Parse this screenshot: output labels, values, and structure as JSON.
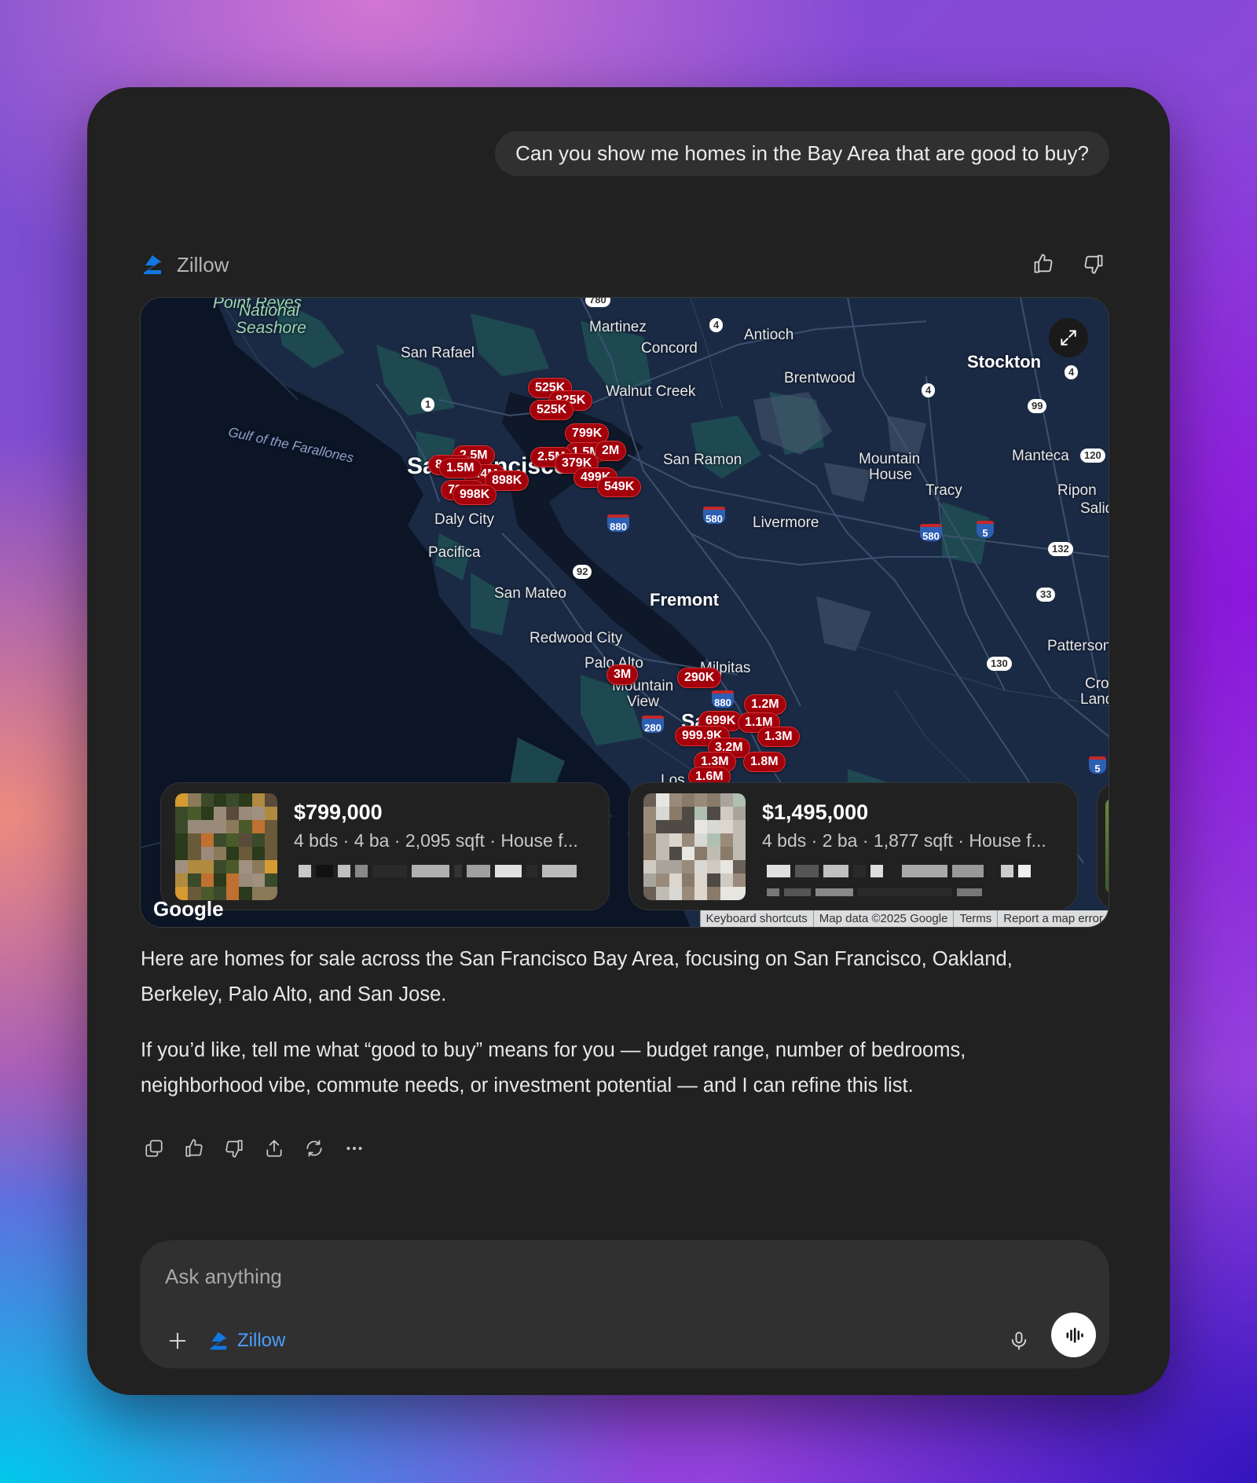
{
  "conversation": {
    "user_message": "Can you show me homes in the Bay Area that are good to buy?",
    "tool_name": "Zillow",
    "paragraphs": [
      "Here are homes for sale across the San Francisco Bay Area, focusing on San Francisco, Oakland, Berkeley, Palo Alto, and San Jose.",
      "If you’d like, tell me what “good to buy” means for you — budget range, number of bedrooms, neighborhood vibe, commute needs, or investment potential — and I can refine this list."
    ]
  },
  "map": {
    "places": {
      "point_reyes_1": "National",
      "point_reyes_2": "Seashore",
      "point_reyes_top": "Point Reyes",
      "martinez": "Martinez",
      "antioch": "Antioch",
      "concord": "Concord",
      "san_rafael": "San Rafael",
      "walnut_creek": "Walnut Creek",
      "brentwood": "Brentwood",
      "stockton": "Stockton",
      "gulf": "Gulf of the Farallones",
      "san_francisco": "San Francisco",
      "san_ramon": "San Ramon",
      "mountain_house_1": "Mountain",
      "mountain_house_2": "House",
      "manteca": "Manteca",
      "tracy": "Tracy",
      "ripon": "Ripon",
      "salida": "Salida",
      "daly_city": "Daly City",
      "livermore": "Livermore",
      "pacifica": "Pacifica",
      "san_mateo": "San Mateo",
      "fremont": "Fremont",
      "redwood_city": "Redwood City",
      "palo_alto": "Palo Alto",
      "milpitas": "Milpitas",
      "mountain_view_1": "Mountain",
      "mountain_view_2": "View",
      "patterson": "Patterson",
      "crows_landing_1": "Crows",
      "crows_landing_2": "Landing",
      "san_jose": "San Jose",
      "los_gatos": "Los Gatos"
    },
    "routes": [
      "780",
      "4",
      "1",
      "4",
      "4",
      "99",
      "120",
      "132",
      "33",
      "130",
      "92"
    ],
    "interstates": [
      "880",
      "580",
      "580",
      "5",
      "880",
      "280",
      "5"
    ],
    "pins": [
      "525K",
      "825K",
      "799K",
      "1.5M",
      "2M",
      "379K",
      "499K",
      "549K",
      "2.5M",
      "1.5M",
      "998K",
      "2.5M",
      "3M",
      "290K",
      "1.2M",
      "1.1M",
      "699K",
      "999.9K",
      "1.3M",
      "3.2M",
      "1.3M",
      "1.8M",
      "1.6M",
      "795K",
      "898K",
      "1.4M"
    ],
    "expand_icon": "expand-icon",
    "google_logo": "Google",
    "attribution": [
      "Keyboard shortcuts",
      "Map data ©2025 Google",
      "Terms",
      "Report a map error"
    ]
  },
  "listings": [
    {
      "price": "$799,000",
      "details": "4 bds · 4 ba · 2,095 sqft · House f..."
    },
    {
      "price": "$1,495,000",
      "details": "4 bds · 2 ba · 1,877 sqft · House f..."
    }
  ],
  "composer": {
    "placeholder": "Ask anything",
    "tool_chip": "Zillow"
  },
  "colors": {
    "accent_blue": "#1277e1",
    "pin_red": "#a4000c",
    "window_bg": "#212121"
  }
}
